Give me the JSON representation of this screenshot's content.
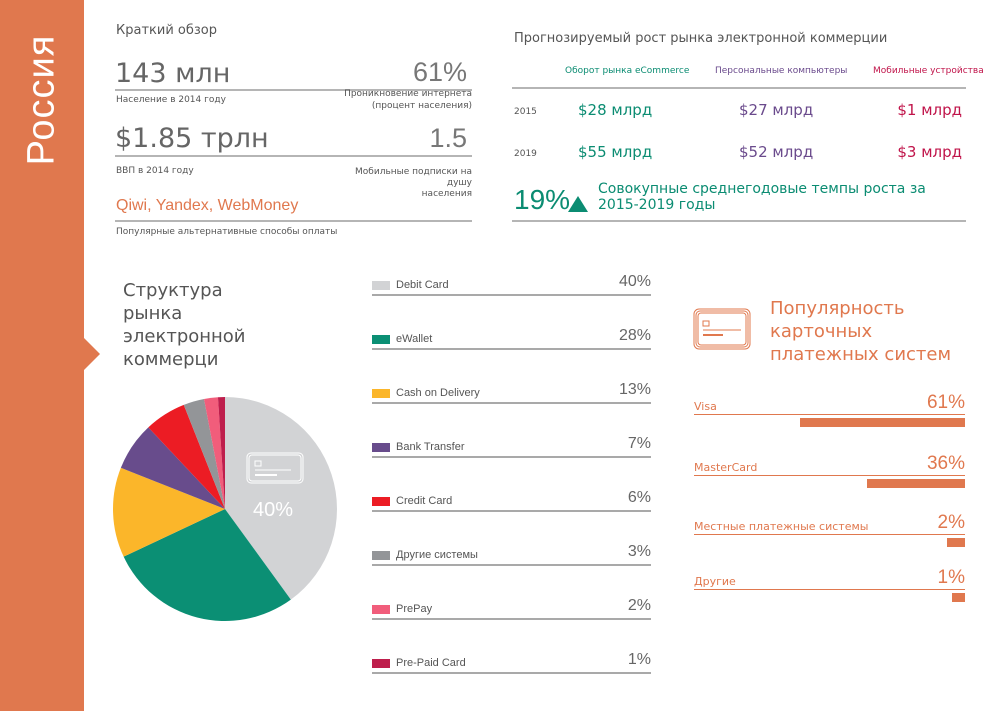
{
  "sidebar": {
    "country": "Россия",
    "color": "#e0784e"
  },
  "overview": {
    "title": "Краткий обзор",
    "population_value": "143 млн",
    "population_label": "Население в 2014 году",
    "internet_value": "61%",
    "internet_label_1": "Проникновение интернета",
    "internet_label_2": "(процент населения)",
    "gdp_value": "$1.85 трлн",
    "gdp_label": "ВВП в 2014 году",
    "mobile_value": "1.5",
    "mobile_label_1": "Мобильные подписки на",
    "mobile_label_2": "душу",
    "mobile_label_3": "населения",
    "alt_payments": "Qiwi, Yandex, WebMoney",
    "alt_payments_label": "Популярные альтернативные способы оплаты"
  },
  "growth": {
    "title": "Прогнозируемый рост рынка электронной коммерции",
    "columns": [
      {
        "label": "Оборот рынка eCommerce",
        "color": "#0b8c72"
      },
      {
        "label": "Персональные компьютеры",
        "color": "#6a4a8c"
      },
      {
        "label": "Мобильные устройства",
        "color": "#c0144a"
      }
    ],
    "rows": [
      {
        "year": "2015",
        "values": [
          "$28 млрд",
          "$27 млрд",
          "$1 млрд"
        ]
      },
      {
        "year": "2019",
        "values": [
          "$55 млрд",
          "$52 млрд",
          "$3 млрд"
        ]
      }
    ],
    "cagr_value": "19%",
    "cagr_text_1": "Совокупные среднегодовые темпы роста за",
    "cagr_text_2": "2015-2019 годы"
  },
  "market_structure": {
    "title_lines": [
      "Структура",
      "рынка",
      "электронной",
      "коммерци"
    ],
    "center_label": "40%"
  },
  "chart_data": [
    {
      "type": "pie",
      "title": "Структура рынка электронной коммерци",
      "categories": [
        "Debit Card",
        "eWallet",
        "Cash on Delivery",
        "Bank Transfer",
        "Credit Card",
        "Другие системы",
        "PrePay",
        "Pre-Paid Card"
      ],
      "values": [
        40,
        28,
        13,
        7,
        6,
        3,
        2,
        1
      ],
      "labels": [
        "40%",
        "28%",
        "13%",
        "7%",
        "6%",
        "3%",
        "2%",
        "1%"
      ],
      "colors": [
        "#d2d3d5",
        "#0b8f74",
        "#fbb62a",
        "#684c8c",
        "#ec1c24",
        "#939598",
        "#f15d7b",
        "#be1e4c"
      ],
      "legend": "right"
    },
    {
      "type": "bar",
      "title": "Популярность карточных платежных систем",
      "categories": [
        "Visa",
        "MasterCard",
        "Местные платежные системы",
        "Другие"
      ],
      "values": [
        61,
        36,
        2,
        1
      ],
      "labels": [
        "61%",
        "36%",
        "2%",
        "1%"
      ],
      "orientation": "horizontal",
      "color": "#e0784e"
    }
  ]
}
